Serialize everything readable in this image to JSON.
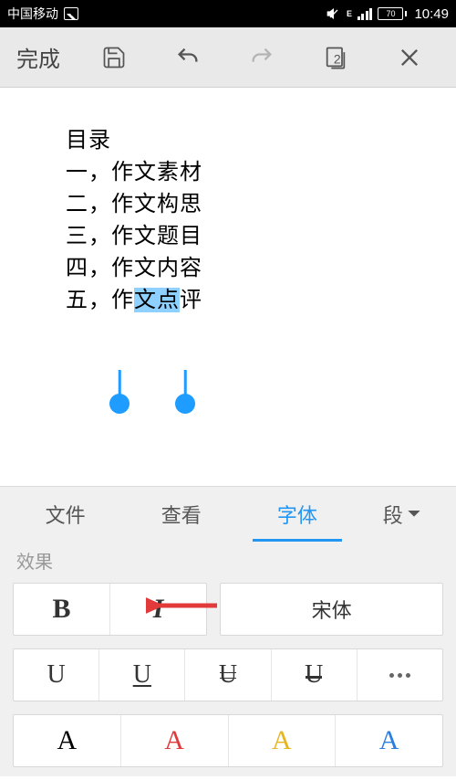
{
  "status": {
    "carrier": "中国移动",
    "net": "E",
    "battery": "70",
    "time": "10:49"
  },
  "toolbar": {
    "done": "完成",
    "pageCount": "2"
  },
  "doc": {
    "title": "目录",
    "l1": "一，作文素材",
    "l2": "二，作文构思",
    "l3": "三，作文题目",
    "l4": "四，作文内容",
    "l5a": "五，作",
    "l5s": "文点",
    "l5b": "评"
  },
  "tabs": {
    "file": "文件",
    "view": "查看",
    "font": "字体",
    "para": "段"
  },
  "effect": "效果",
  "style": {
    "bold": "B",
    "ital": "I",
    "fontFamily": "宋体",
    "u1": "U",
    "u2": "U",
    "u3": "U",
    "u4": "U",
    "a": "A"
  },
  "colors": {
    "c1": "#000000",
    "c2": "#e23a3a",
    "c3": "#e6b51f",
    "c4": "#2b7de0"
  }
}
